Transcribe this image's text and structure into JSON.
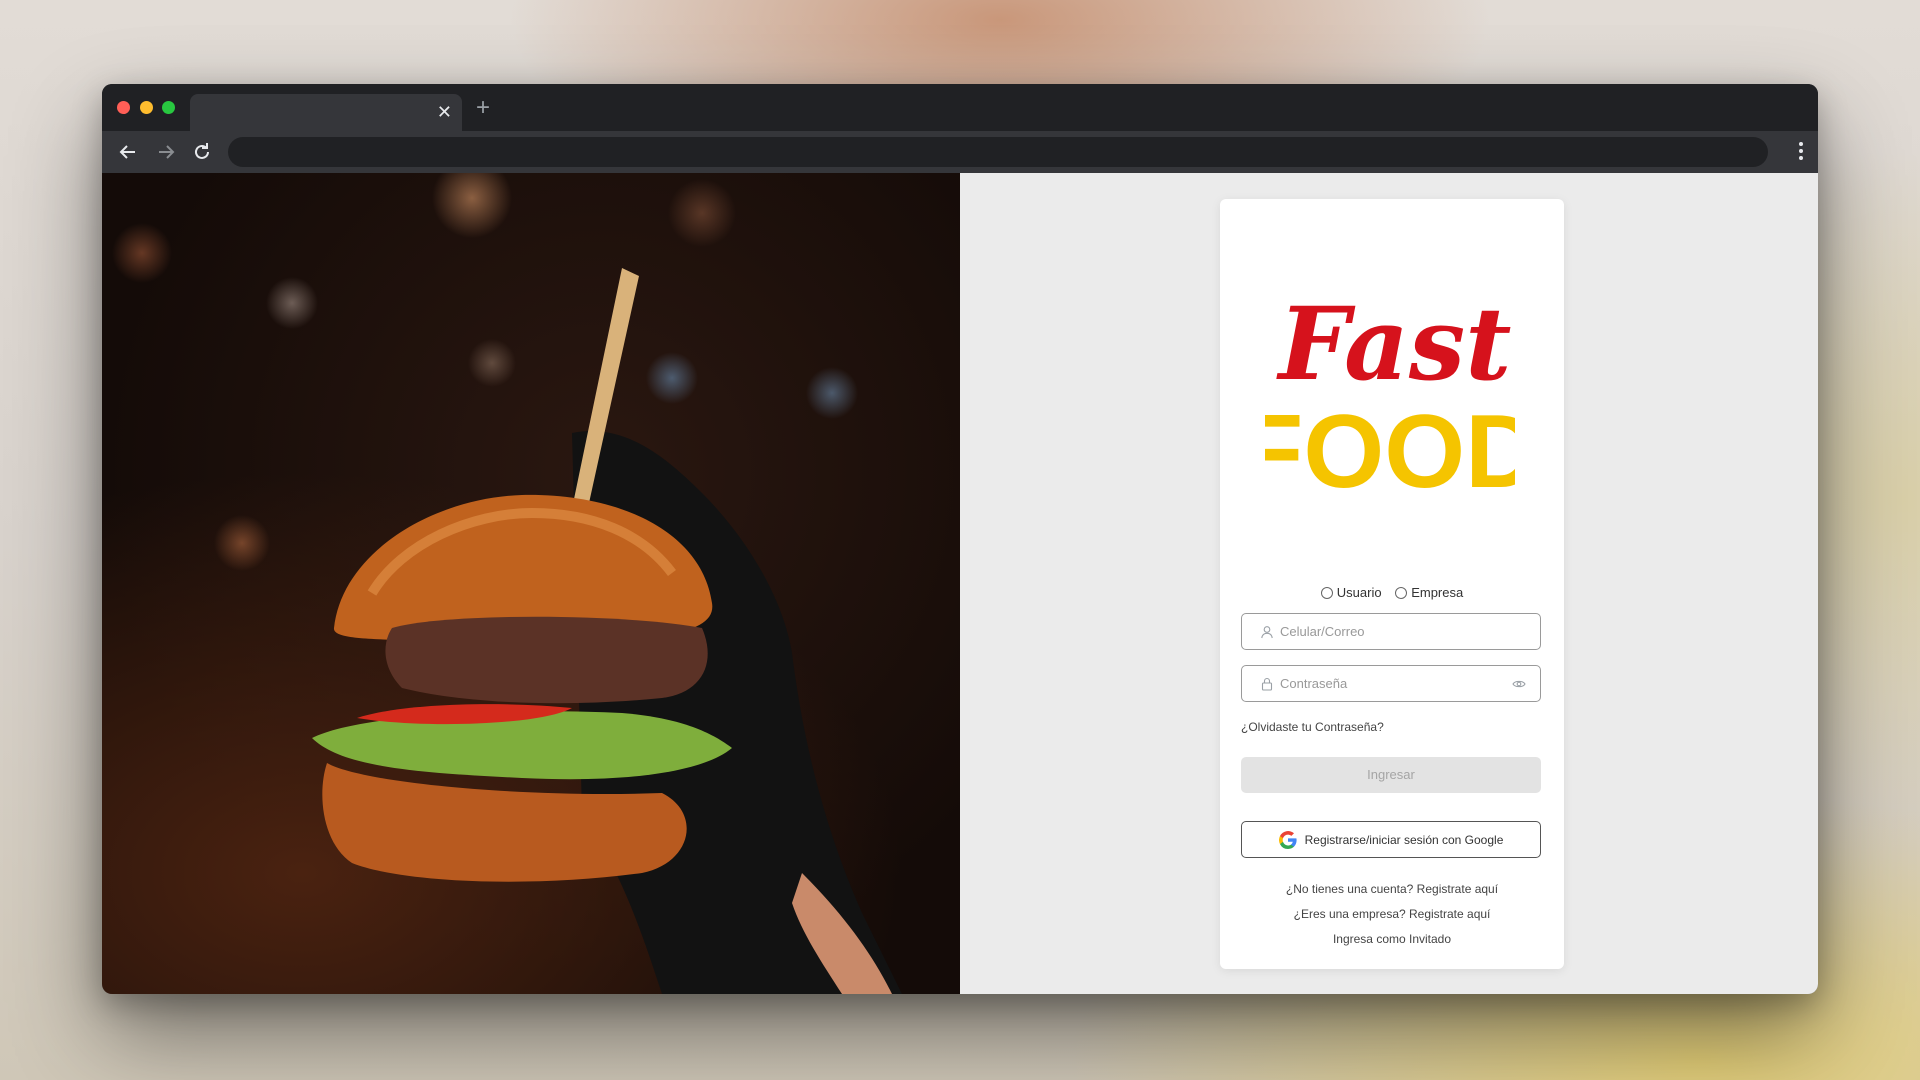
{
  "browser": {
    "new_tab_symbol": "+",
    "close_tab_symbol": "✕"
  },
  "logo": {
    "script_text": "Fast",
    "block_text": "FOOD",
    "script_color": "#d6121c",
    "block_color": "#f5c400"
  },
  "login": {
    "account_types": [
      {
        "label": "Usuario",
        "selected": false
      },
      {
        "label": "Empresa",
        "selected": false
      }
    ],
    "username_placeholder": "Celular/Correo",
    "password_placeholder": "Contraseña",
    "forgot_password": "¿Olvidaste tu Contraseña?",
    "submit_label": "Ingresar",
    "google_label": "Registrarse/iniciar sesión con Google",
    "register_link": "¿No tienes una cuenta? Registrate aquí",
    "business_link": "¿Eres una empresa? Registrate aquí",
    "guest_link": "Ingresa como Invitado"
  },
  "colors": {
    "page_background": "#ebebeb",
    "card_background": "#ffffff",
    "button_disabled": "#e3e3e3"
  }
}
